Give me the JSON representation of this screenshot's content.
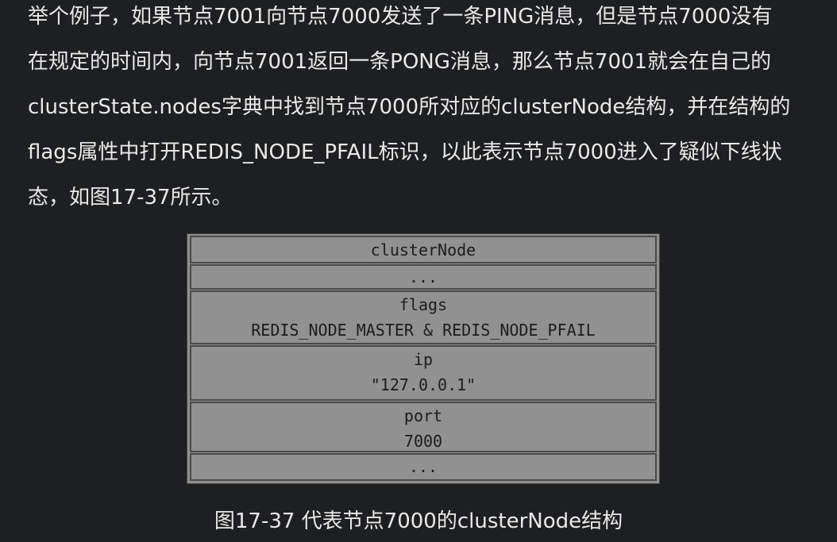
{
  "paragraph": {
    "lines": [
      "举个例子，如果节点7001向节点7000发送了一条PING消息，但是节点7000没有",
      "在规定的时间内，向节点7001返回一条PONG消息，那么节点7001就会在自己的",
      "clusterState.nodes字典中找到节点7000所对应的clusterNode结构，并在结构的",
      "flags属性中打开REDIS_NODE_PFAIL标识，以此表示节点7000进入了疑似下线状",
      "态，如图17-37所示。"
    ]
  },
  "figure": {
    "title": "clusterNode",
    "ellipsis_top": "...",
    "flags_label": "flags",
    "flags_value": "REDIS_NODE_MASTER & REDIS_NODE_PFAIL",
    "ip_label": "ip",
    "ip_value": "\"127.0.0.1\"",
    "port_label": "port",
    "port_value": "7000",
    "ellipsis_bottom": "..."
  },
  "caption": "图17-37 代表节点7000的clusterNode结构"
}
